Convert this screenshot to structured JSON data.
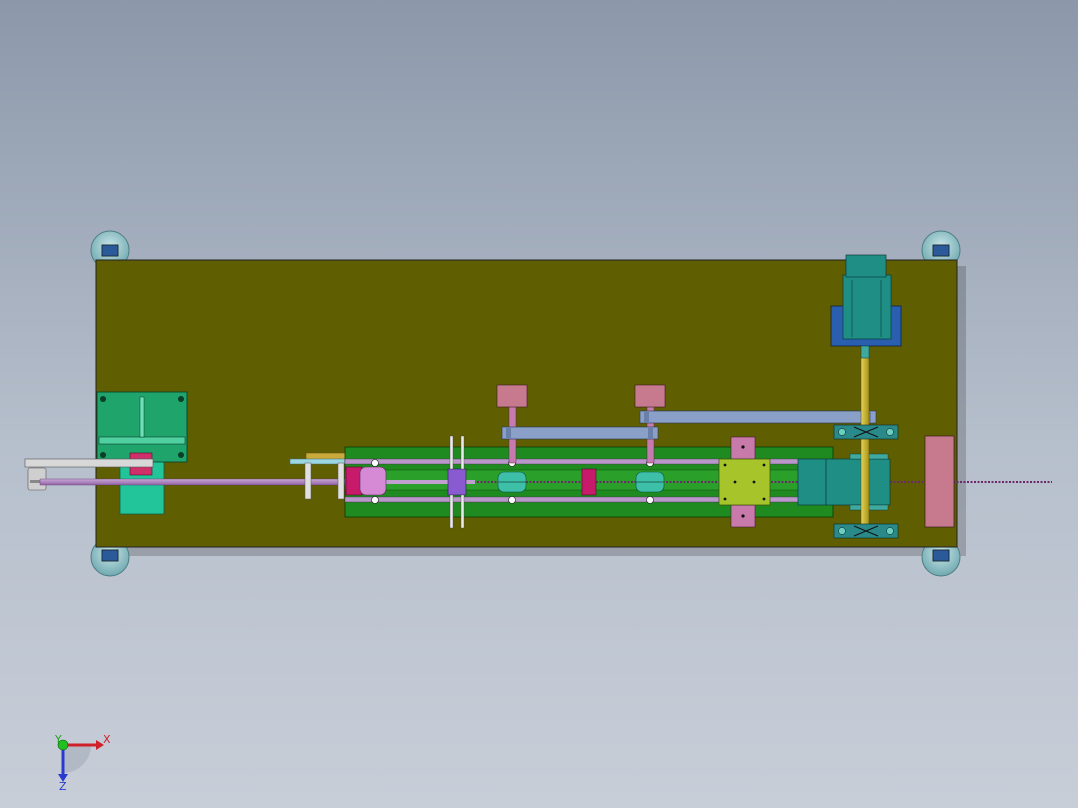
{
  "view": {
    "kind": "cad-assembly-top-view",
    "background_top": "#8c98aa",
    "background_bottom": "#c8ced8"
  },
  "colors": {
    "base_plate": "#5f5e00",
    "rail_green": "#1f8a1f",
    "rod_violet": "#b07ac0",
    "motor_teal": "#1f8f86",
    "motor_blue": "#2a5fb0",
    "lead_screw": "#c8b21e",
    "pink_block": "#c77a8e",
    "lime_carriage": "#a7c52a",
    "foot_cyan": "#8fc4c9",
    "slate_bar": "#8aa0c8"
  },
  "triad": {
    "x_label": "X",
    "y_label": "Y",
    "z_label": "Z",
    "icons": [
      "triad-x-arrow-icon",
      "triad-y-arrow-icon",
      "triad-z-arrow-icon"
    ]
  }
}
